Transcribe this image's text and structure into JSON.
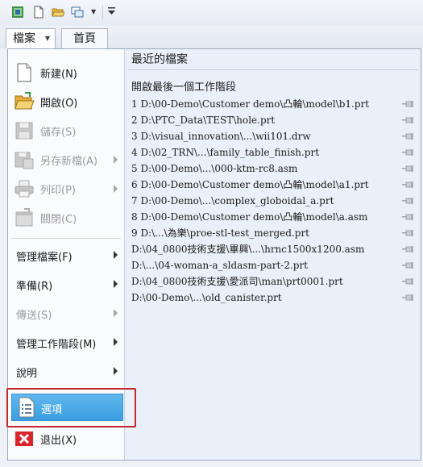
{
  "ribbon": {
    "file_tab": "檔案",
    "home_tab": "首頁"
  },
  "left_menu": {
    "items": [
      {
        "label": "新建(N)",
        "enabled": true
      },
      {
        "label": "開啟(O)",
        "enabled": true
      },
      {
        "label": "儲存(S)",
        "enabled": false
      },
      {
        "label": "另存新檔(A)",
        "enabled": false
      },
      {
        "label": "列印(P)",
        "enabled": false
      },
      {
        "label": "關閉(C)",
        "enabled": false
      }
    ],
    "submenus": [
      {
        "label": "管理檔案(F)",
        "enabled": true
      },
      {
        "label": "準備(R)",
        "enabled": true
      },
      {
        "label": "傳送(S)",
        "enabled": false
      },
      {
        "label": "管理工作階段(M)",
        "enabled": true
      },
      {
        "label": "說明",
        "enabled": true
      }
    ],
    "options": "選項",
    "exit": "退出(X)"
  },
  "recent": {
    "title": "最近的檔案",
    "open_last_session": "開啟最後一個工作階段",
    "files": [
      "1 D:\\00-Demo\\Customer demo\\凸輪\\model\\b1.prt",
      "2 D:\\PTC_Data\\TEST\\hole.prt",
      "3 D:\\visual_innovation\\...\\wii101.drw",
      "4 D:\\02_TRN\\...\\family_table_finish.prt",
      "5 D:\\00-Demo\\...\\000-ktm-rc8.asm",
      "6 D:\\00-Demo\\Customer demo\\凸輪\\model\\a1.prt",
      "7 D:\\00-Demo\\...\\complex_globoidal_a.prt",
      "8 D:\\00-Demo\\Customer demo\\凸輪\\model\\a.asm",
      "9 D:\\...\\為樂\\proe-stl-test_merged.prt",
      "D:\\04_0800技術支援\\畢興\\...\\hrnc1500x1200.asm",
      "D:\\...\\04-woman-a_sldasm-part-2.prt",
      "D:\\04_0800技術支援\\愛派司\\man\\prt0001.prt",
      "D:\\00-Demo\\...\\old_canister.prt"
    ]
  },
  "colors": {
    "selection_blue": "#3a9ee0",
    "highlight_red": "#c1272d",
    "exit_red": "#d9262c"
  }
}
